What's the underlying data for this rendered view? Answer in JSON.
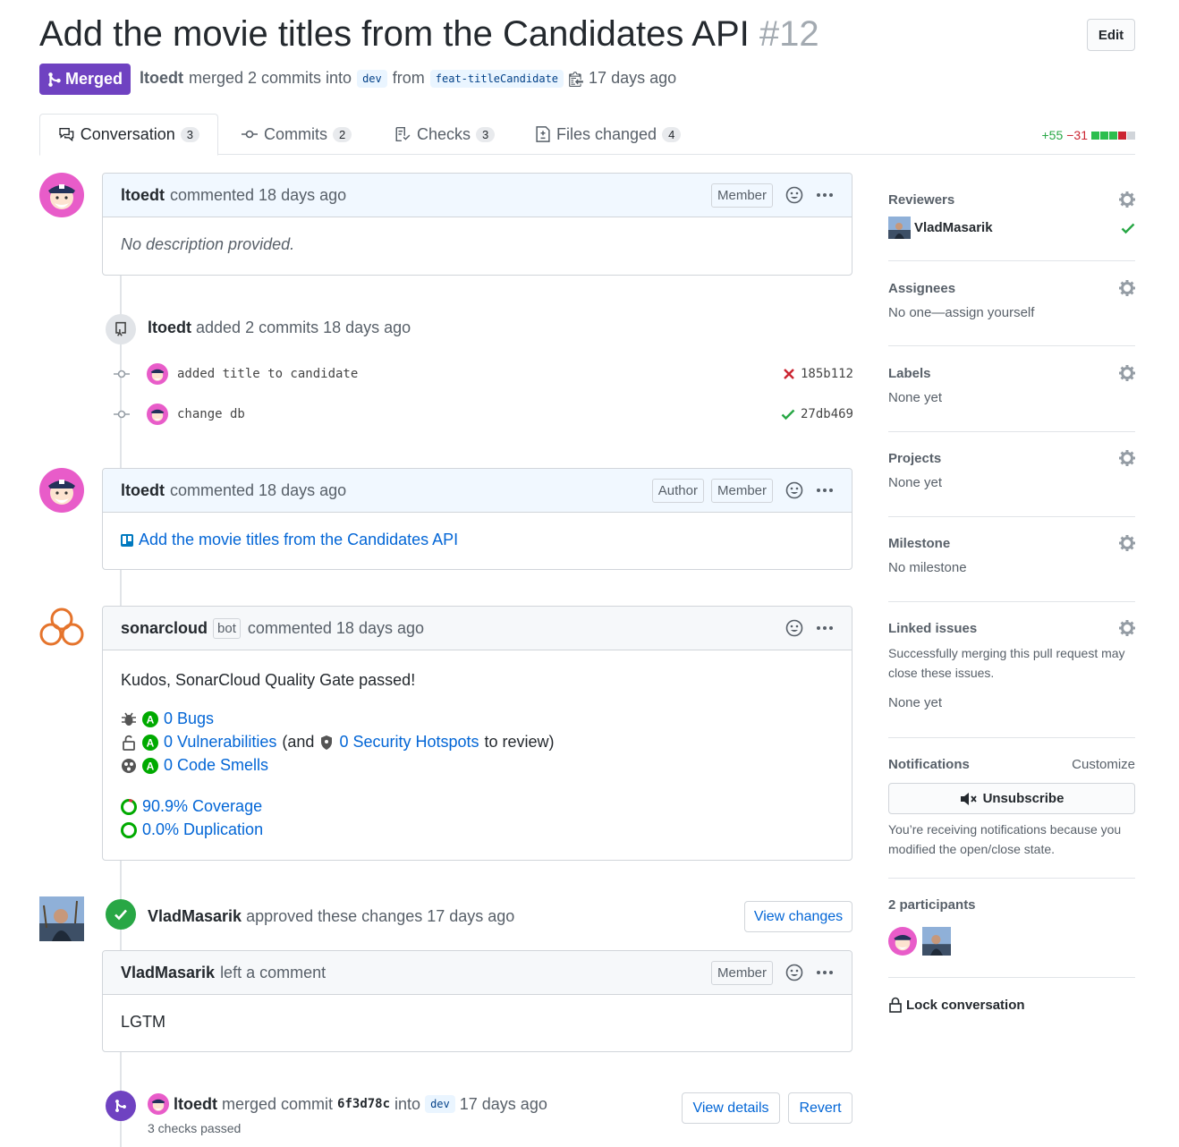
{
  "pr": {
    "title": "Add the movie titles from the Candidates API",
    "number": "#12",
    "edit_label": "Edit",
    "state_label": "Merged",
    "author": "ltoedt",
    "merge_text": "merged 2 commits into",
    "base_branch": "dev",
    "from_text": "from",
    "head_branch": "feat-titleCandidate",
    "time": "17 days ago"
  },
  "tabs": [
    {
      "label": "Conversation",
      "count": "3",
      "icon": "comment-discussion-icon"
    },
    {
      "label": "Commits",
      "count": "2",
      "icon": "git-commit-icon"
    },
    {
      "label": "Checks",
      "count": "3",
      "icon": "checklist-icon"
    },
    {
      "label": "Files changed",
      "count": "4",
      "icon": "file-diff-icon"
    }
  ],
  "diffstat": {
    "additions": "+55",
    "deletions": "−31",
    "colors": [
      "#2cbe4e",
      "#2cbe4e",
      "#2cbe4e",
      "#cb2431",
      "#d1d5da"
    ]
  },
  "timeline": {
    "comment1": {
      "author": "ltoedt",
      "action": "commented 18 days ago",
      "badge": "Member",
      "body": "No description provided."
    },
    "commits_event": {
      "author": "ltoedt",
      "action": "added 2 commits 18 days ago"
    },
    "commits": [
      {
        "message": "added title to candidate",
        "sha": "185b112",
        "status": "fail"
      },
      {
        "message": "change db",
        "sha": "27db469",
        "status": "success"
      }
    ],
    "comment2": {
      "author": "ltoedt",
      "action": "commented 18 days ago",
      "badge_author": "Author",
      "badge_member": "Member",
      "link": "Add the movie titles from the Candidates API"
    },
    "comment3": {
      "author": "sonarcloud",
      "bot_label": "bot",
      "action": "commented 18 days ago",
      "intro": "Kudos, SonarCloud Quality Gate passed!",
      "bugs": "0 Bugs",
      "vulns": "0 Vulnerabilities",
      "and_text": "(and",
      "hotspots": "0 Security Hotspots",
      "review_text": "to review)",
      "smells": "0 Code Smells",
      "grade": "A",
      "coverage": "90.9% Coverage",
      "duplication": "0.0% Duplication"
    },
    "review": {
      "author": "VladMasarik",
      "action": "approved these changes 17 days ago",
      "view_changes": "View changes"
    },
    "review_comment": {
      "author": "VladMasarik",
      "action": "left a comment",
      "badge": "Member",
      "body": "LGTM"
    },
    "merge_event": {
      "author": "ltoedt",
      "action": "merged commit",
      "sha": "6f3d78c",
      "into": "into",
      "branch": "dev",
      "time": "17 days ago",
      "checks": "3 checks passed",
      "view_details": "View details",
      "revert": "Revert"
    }
  },
  "sidebar": {
    "reviewers": {
      "heading": "Reviewers",
      "name": "VladMasarik"
    },
    "assignees": {
      "heading": "Assignees",
      "value": "No one—assign yourself"
    },
    "labels": {
      "heading": "Labels",
      "value": "None yet"
    },
    "projects": {
      "heading": "Projects",
      "value": "None yet"
    },
    "milestone": {
      "heading": "Milestone",
      "value": "No milestone"
    },
    "linked": {
      "heading": "Linked issues",
      "desc": "Successfully merging this pull request may close these issues.",
      "value": "None yet"
    },
    "notifications": {
      "heading": "Notifications",
      "customize": "Customize",
      "button": "Unsubscribe",
      "desc": "You’re receiving notifications because you modified the open/close state."
    },
    "participants": {
      "heading": "2 participants"
    },
    "lock": "Lock conversation"
  }
}
